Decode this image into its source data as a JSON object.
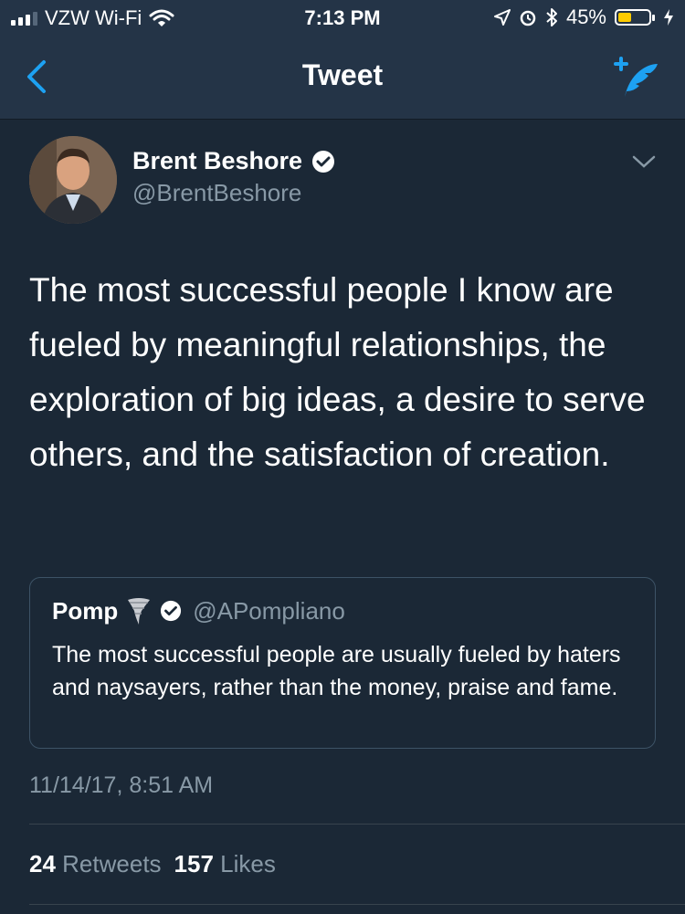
{
  "status_bar": {
    "carrier": "VZW Wi-Fi",
    "time": "7:13 PM",
    "battery_percent": "45%",
    "battery_level": 0.45,
    "icons": [
      "signal-bars-icon",
      "wifi-icon",
      "location-arrow-icon",
      "alarm-icon",
      "bluetooth-icon",
      "battery-icon",
      "charging-bolt-icon"
    ]
  },
  "nav": {
    "title": "Tweet",
    "back_icon": "chevron-left-icon",
    "compose_icon": "compose-tweet-icon"
  },
  "tweet": {
    "author_name": "Brent Beshore",
    "author_handle": "@BrentBeshore",
    "verified": true,
    "text": "The most successful people I know are fueled by meaningful relationships, the exploration of big ideas, a desire to serve others, and the satisfaction of creation.",
    "timestamp": "11/14/17, 8:51 AM",
    "retweets_count": "24",
    "retweets_label": "Retweets",
    "likes_count": "157",
    "likes_label": "Likes"
  },
  "quoted_tweet": {
    "author_name": "Pomp",
    "author_emoji_icon": "tornado-icon",
    "verified": true,
    "author_handle": "@APompliano",
    "text": "The most successful people are usually fueled by haters and naysayers, rather than the money, praise and fame."
  },
  "colors": {
    "background": "#1b2836",
    "nav_background": "#243447",
    "accent": "#1da1f2",
    "secondary_text": "#8899a6",
    "battery_fill": "#ffcc00"
  }
}
